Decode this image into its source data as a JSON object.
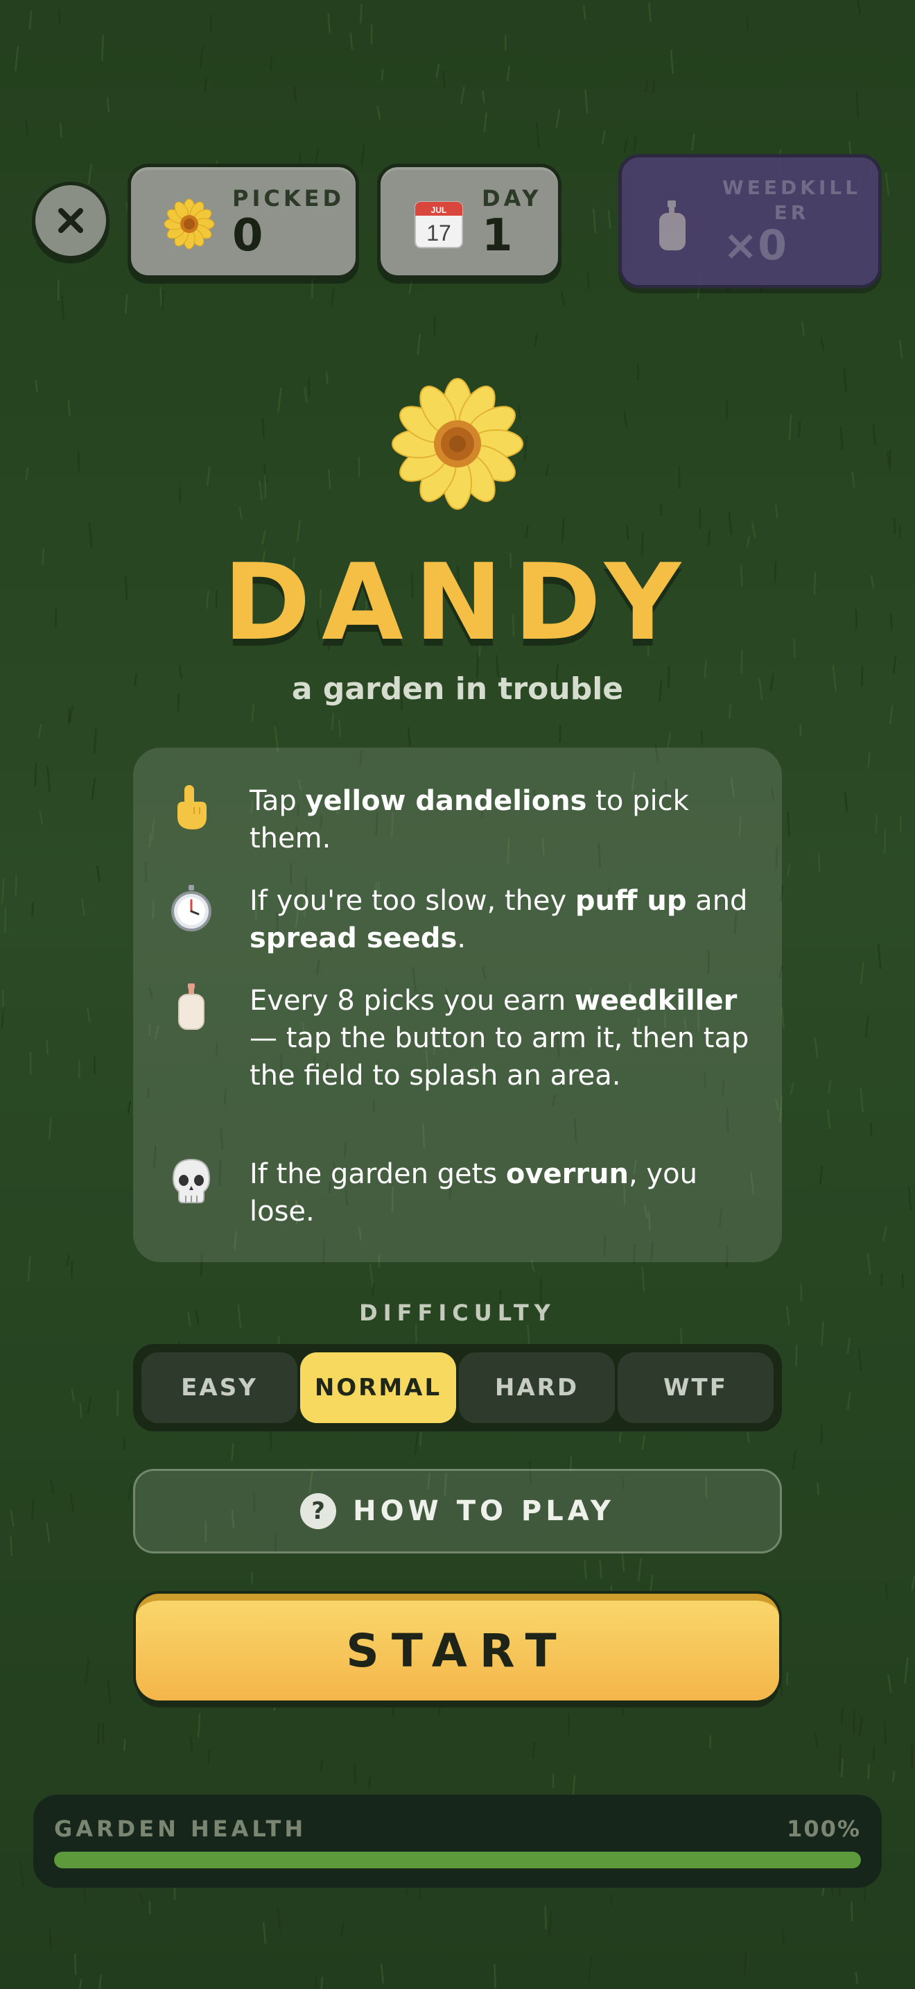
{
  "hud": {
    "picked": {
      "label": "PICKED",
      "value": "0",
      "icon": "sunflower-icon"
    },
    "day": {
      "label": "DAY",
      "value": "1",
      "icon": "calendar-icon",
      "calendar_day": "17",
      "calendar_month": "JUL"
    },
    "weedkiller": {
      "label_line1": "WEEDKILL",
      "label_line2": "ER",
      "count": "×0",
      "icon": "lotion-bottle-icon"
    },
    "close_icon": "close-icon"
  },
  "title": "DANDY",
  "subtitle": "a garden in trouble",
  "rules": [
    {
      "icon": "pointing-finger-icon",
      "pre": "Tap ",
      "bold": "yellow dandelions",
      "post": " to pick them."
    },
    {
      "icon": "stopwatch-icon",
      "pre": "If you're too slow, they ",
      "bold": "puff up",
      "mid": " and ",
      "bold2": "spread seeds",
      "post": "."
    },
    {
      "icon": "lotion-bottle-icon",
      "pre": "Every 8 picks you earn ",
      "bold": "weedkiller",
      "post": " — tap the button to arm it, then tap the field to splash an area."
    },
    {
      "icon": "skull-icon",
      "pre": "If the garden gets ",
      "bold": "overrun",
      "post": ", you lose."
    }
  ],
  "difficulty": {
    "label": "DIFFICULTY",
    "options": [
      "EASY",
      "NORMAL",
      "HARD",
      "WTF"
    ],
    "selected": "NORMAL"
  },
  "how_to_play": {
    "label": "HOW TO PLAY",
    "icon": "question-icon",
    "glyph": "?"
  },
  "start": {
    "label": "START"
  },
  "health": {
    "label": "GARDEN HEALTH",
    "value_text": "100%",
    "fraction": 1.0
  },
  "colors": {
    "accent": "#f5bf45",
    "selected": "#f8d960",
    "health_fill": "#5d9a3c"
  }
}
